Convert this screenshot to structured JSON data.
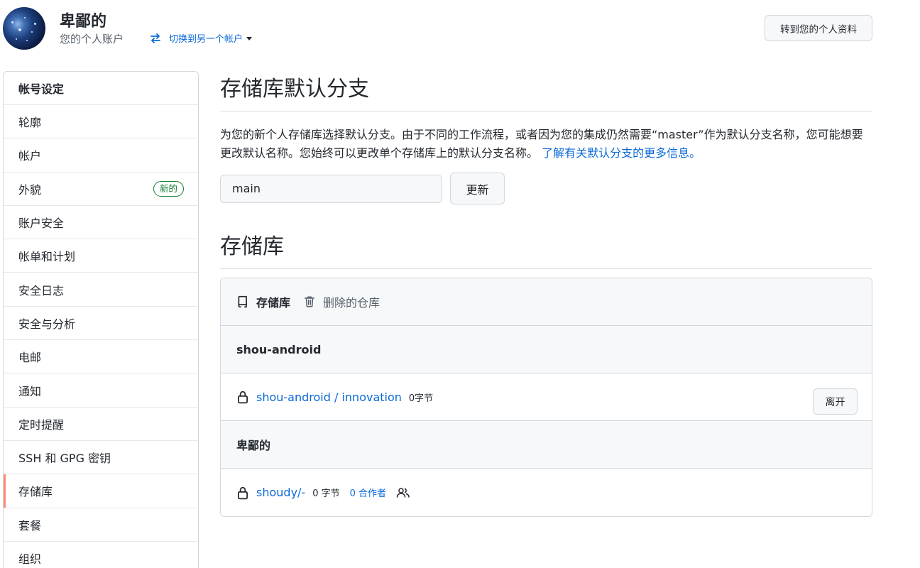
{
  "header": {
    "user_name": "卑鄙的",
    "subtitle": "您的个人账户",
    "switch_label": "切换到另一个帐户",
    "profile_button": "转到您的个人资料"
  },
  "sidebar": {
    "heading": "帐号设定",
    "items": [
      {
        "label": "轮廓"
      },
      {
        "label": "帐户"
      },
      {
        "label": "外貌",
        "badge": "新的"
      },
      {
        "label": "账户安全"
      },
      {
        "label": "帐单和计划"
      },
      {
        "label": "安全日志"
      },
      {
        "label": "安全与分析"
      },
      {
        "label": "电邮"
      },
      {
        "label": "通知"
      },
      {
        "label": "定时提醒"
      },
      {
        "label": "SSH 和 GPG 密钥"
      },
      {
        "label": "存储库",
        "active": true
      },
      {
        "label": "套餐"
      },
      {
        "label": "组织"
      }
    ]
  },
  "main": {
    "default_branch": {
      "title": "存储库默认分支",
      "description": "为您的新个人存储库选择默认分支。由于不同的工作流程，或者因为您的集成仍然需要“master”作为默认分支名称，您可能想要更改默认名称。您始终可以更改单个存储库上的默认分支名称。",
      "learn_more": "了解有关默认分支的更多信息。",
      "input_value": "main",
      "update_button": "更新"
    },
    "repositories": {
      "title": "存储库",
      "tab_repos": "存储库",
      "tab_deleted": "删除的仓库",
      "groups": [
        {
          "name": "shou-android",
          "repos": [
            {
              "name": "shou-android / innovation",
              "size": "0字节",
              "leave": "离开"
            }
          ]
        },
        {
          "name": "卑鄙的",
          "repos": [
            {
              "name": "shoudy/-",
              "size": "0 字节",
              "collaborators": "0 合作者"
            }
          ]
        }
      ]
    }
  },
  "colors": {
    "link": "#0969da",
    "active_marker": "#fd8c73",
    "badge_green": "#1a7f37",
    "border": "#d0d7de"
  }
}
